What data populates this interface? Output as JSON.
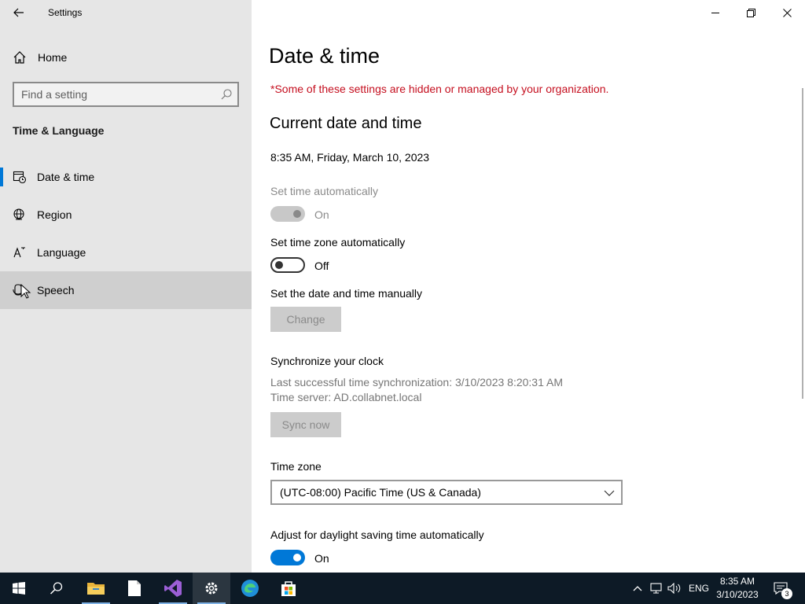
{
  "window": {
    "title": "Settings",
    "back_icon": "back-arrow-icon",
    "controls": {
      "minimize_icon": "minimize-icon",
      "maximize_icon": "restore-icon",
      "close_icon": "close-icon"
    }
  },
  "sidebar": {
    "home_label": "Home",
    "search": {
      "placeholder": "Find a setting",
      "value": ""
    },
    "section_title": "Time & Language",
    "items": [
      {
        "label": "Date & time",
        "icon": "clock-calendar-icon",
        "selected": true
      },
      {
        "label": "Region",
        "icon": "globe-icon",
        "selected": false
      },
      {
        "label": "Language",
        "icon": "language-icon",
        "selected": false
      },
      {
        "label": "Speech",
        "icon": "microphone-icon",
        "selected": false,
        "hover": true
      }
    ]
  },
  "main": {
    "title": "Date & time",
    "org_note": "*Some of these settings are hidden or managed by your organization.",
    "current_heading": "Current date and time",
    "current_value": "8:35 AM, Friday, March 10, 2023",
    "set_time_auto": {
      "label": "Set time automatically",
      "state": "On",
      "disabled": true
    },
    "set_tz_auto": {
      "label": "Set time zone automatically",
      "state": "Off"
    },
    "manual": {
      "label": "Set the date and time manually",
      "button": "Change"
    },
    "sync": {
      "heading": "Synchronize your clock",
      "last_sync": "Last successful time synchronization: 3/10/2023 8:20:31 AM",
      "server": "Time server: AD.collabnet.local",
      "button": "Sync now"
    },
    "timezone": {
      "label": "Time zone",
      "value": "(UTC-08:00) Pacific Time (US & Canada)"
    },
    "dst": {
      "label": "Adjust for daylight saving time automatically",
      "state": "On"
    }
  },
  "taskbar": {
    "apps": [
      "start-icon",
      "search-icon",
      "file-explorer-icon",
      "notepad-icon",
      "visual-studio-icon",
      "settings-icon",
      "edge-icon",
      "store-icon"
    ],
    "tray": {
      "lang": "ENG",
      "time": "8:35 AM",
      "date": "3/10/2023",
      "notification_count": "3"
    }
  },
  "colors": {
    "accent": "#0078d7",
    "warning": "#c50f1f",
    "sidebar_bg": "#e6e6e6",
    "taskbar_bg": "#0d1a26"
  }
}
